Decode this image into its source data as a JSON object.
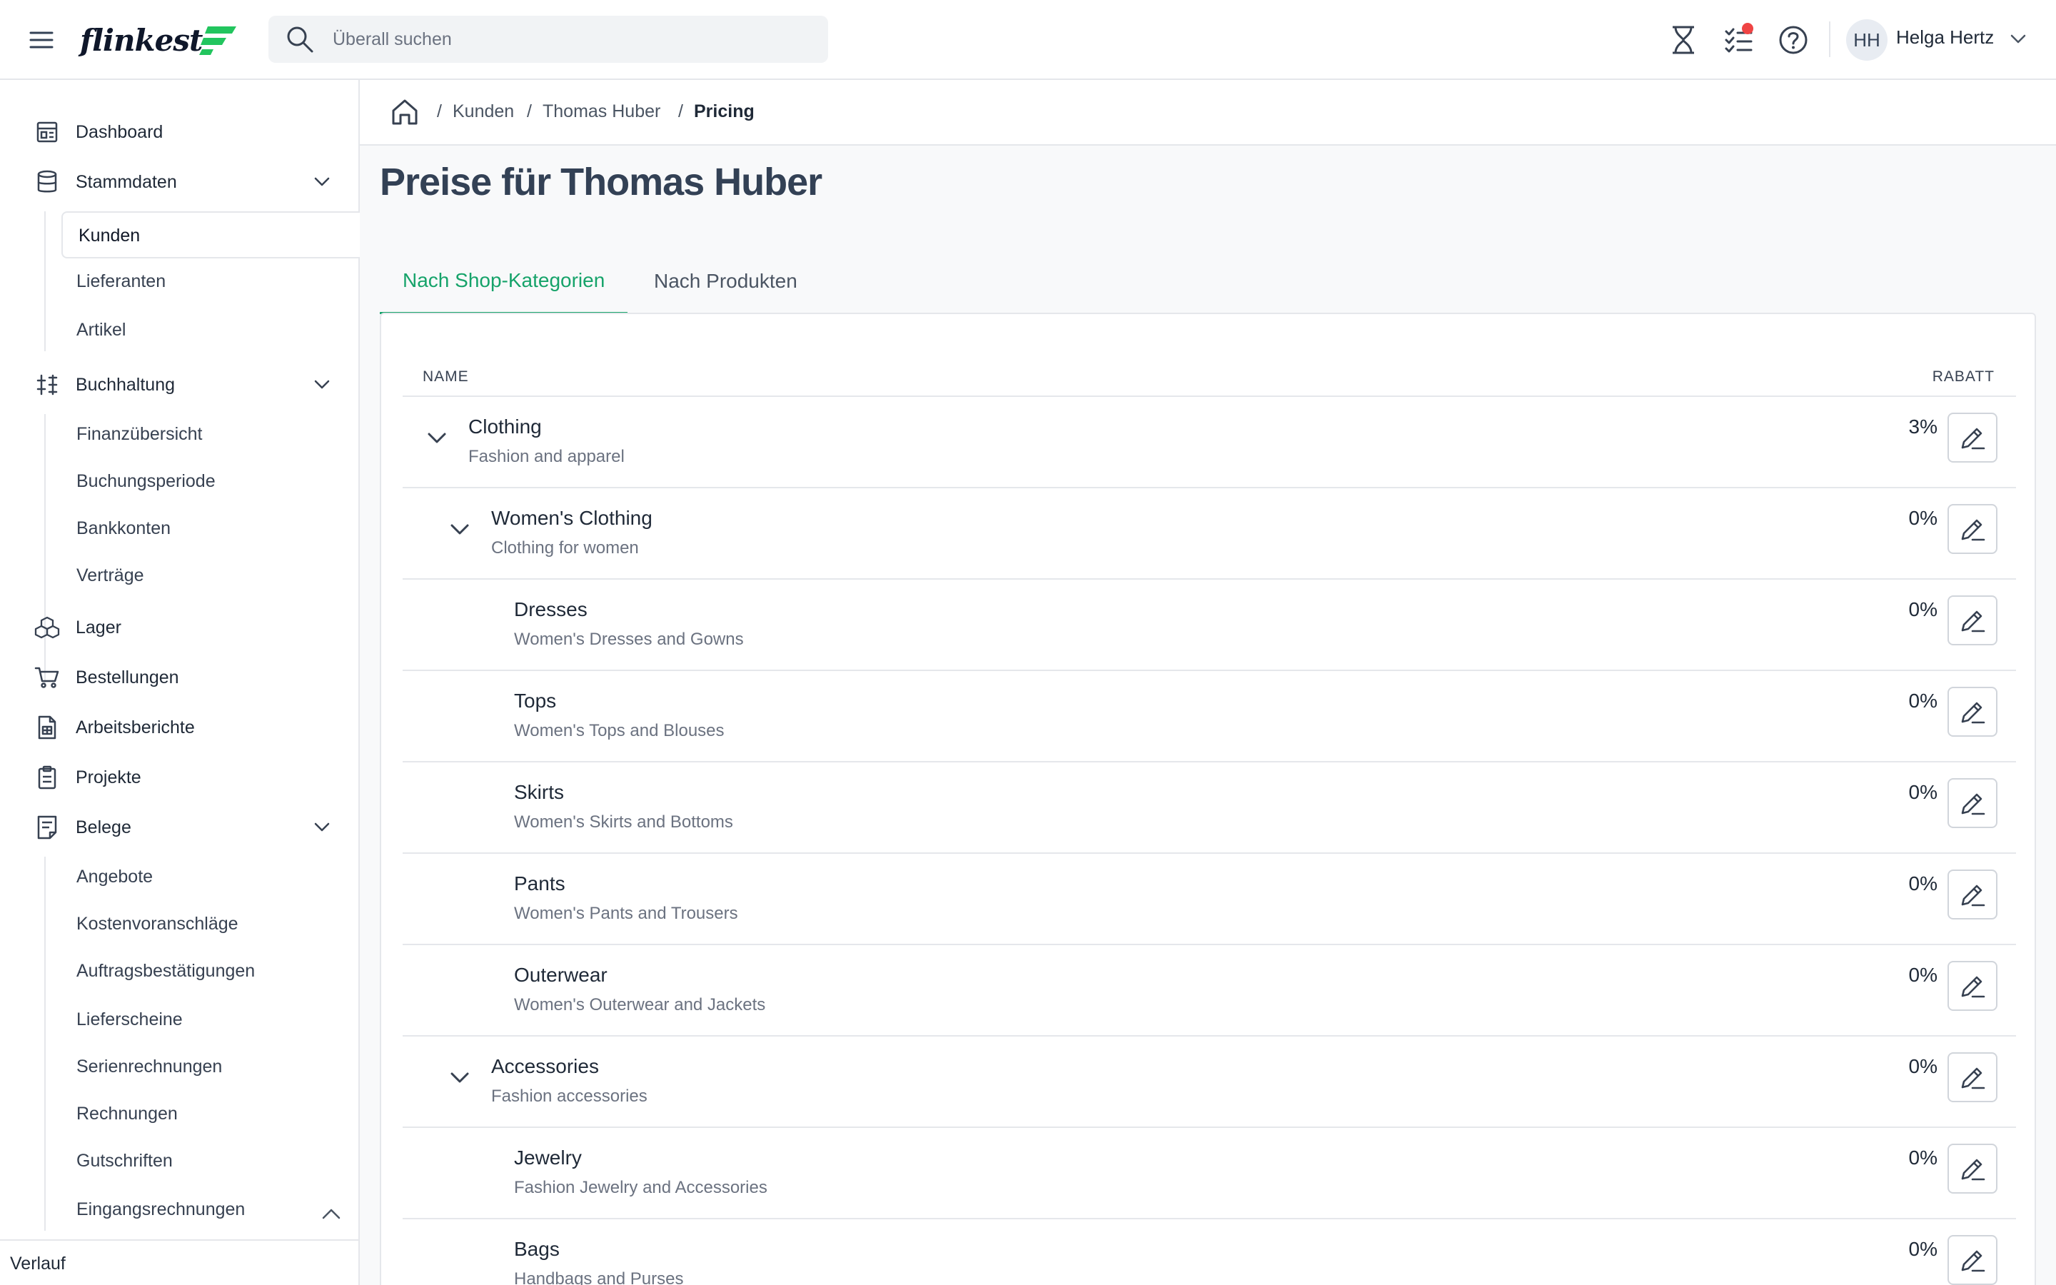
{
  "app": {
    "logo": "flinkest",
    "brand_color": "#22c55e",
    "accent_color": "#16a36a"
  },
  "topbar": {
    "search_placeholder": "Überall suchen",
    "user_initials": "HH",
    "user_name": "Helga Hertz",
    "icons": [
      "menu-icon",
      "search-icon",
      "hourglass-icon",
      "tasks-icon",
      "help-icon",
      "chevron-down-icon"
    ]
  },
  "sidebar": {
    "dashboard": "Dashboard",
    "stammdaten": "Stammdaten",
    "stammdaten_items": [
      "Kunden",
      "Lieferanten",
      "Artikel"
    ],
    "buchhaltung": "Buchhaltung",
    "buchhaltung_items": [
      "Finanzübersicht",
      "Buchungsperiode",
      "Bankkonten",
      "Verträge"
    ],
    "lager": "Lager",
    "bestellungen": "Bestellungen",
    "arbeitsberichte": "Arbeitsberichte",
    "projekte": "Projekte",
    "belege": "Belege",
    "belege_items": [
      "Angebote",
      "Kostenvoranschläge",
      "Auftragsbestätigungen",
      "Lieferscheine",
      "Serienrechnungen",
      "Rechnungen",
      "Gutschriften",
      "Eingangsrechnungen"
    ],
    "verlauf": "Verlauf"
  },
  "breadcrumb": {
    "items": [
      "Kunden",
      "Thomas Huber"
    ],
    "current": "Pricing"
  },
  "page": {
    "title": "Preise für Thomas Huber",
    "tabs": [
      "Nach Shop-Kategorien",
      "Nach Produkten"
    ],
    "active_tab": "Nach Shop-Kategorien"
  },
  "table": {
    "col_name": "NAME",
    "col_discount": "RABATT",
    "rows": [
      {
        "name": "Clothing",
        "desc": "Fashion and apparel",
        "discount": "3%",
        "level": 0,
        "expandable": true
      },
      {
        "name": "Women's Clothing",
        "desc": "Clothing for women",
        "discount": "0%",
        "level": 1,
        "expandable": true
      },
      {
        "name": "Dresses",
        "desc": "Women's Dresses and Gowns",
        "discount": "0%",
        "level": 2,
        "expandable": false
      },
      {
        "name": "Tops",
        "desc": "Women's Tops and Blouses",
        "discount": "0%",
        "level": 2,
        "expandable": false
      },
      {
        "name": "Skirts",
        "desc": "Women's Skirts and Bottoms",
        "discount": "0%",
        "level": 2,
        "expandable": false
      },
      {
        "name": "Pants",
        "desc": "Women's Pants and Trousers",
        "discount": "0%",
        "level": 2,
        "expandable": false
      },
      {
        "name": "Outerwear",
        "desc": "Women's Outerwear and Jackets",
        "discount": "0%",
        "level": 2,
        "expandable": false
      },
      {
        "name": "Accessories",
        "desc": "Fashion accessories",
        "discount": "0%",
        "level": 1,
        "expandable": true
      },
      {
        "name": "Jewelry",
        "desc": "Fashion Jewelry and Accessories",
        "discount": "0%",
        "level": 2,
        "expandable": false
      },
      {
        "name": "Bags",
        "desc": "Handbags and Purses",
        "discount": "0%",
        "level": 2,
        "expandable": false
      }
    ]
  }
}
